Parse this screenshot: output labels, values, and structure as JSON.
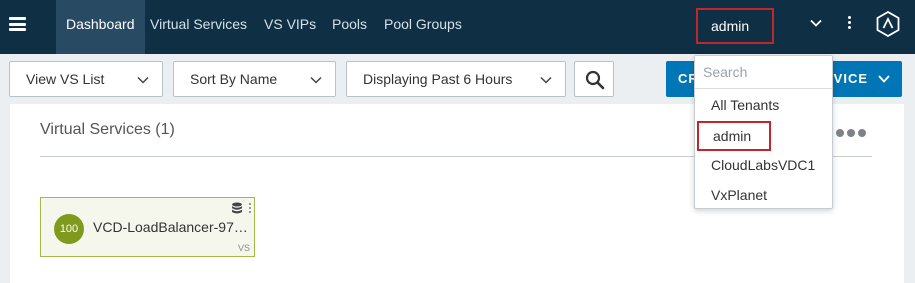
{
  "nav": {
    "tabs": [
      {
        "label": "Dashboard",
        "active": true
      },
      {
        "label": "Virtual Services",
        "active": false
      },
      {
        "label": "VS VIPs",
        "active": false
      },
      {
        "label": "Pools",
        "active": false
      },
      {
        "label": "Pool Groups",
        "active": false
      }
    ],
    "tenant": "admin"
  },
  "filters": {
    "view": "View VS List",
    "sort": "Sort By Name",
    "time": "Displaying Past 6 Hours",
    "create_left": "CR",
    "create_right": "VICE"
  },
  "panel": {
    "title": "Virtual Services (1)",
    "virtual_services": [
      {
        "health": "100",
        "name": "VCD-LoadBalancer-97c...",
        "tag": "VS"
      }
    ]
  },
  "tenant_menu": {
    "search_placeholder": "Search",
    "items": [
      "All Tenants",
      "admin",
      "CloudLabsVDC1",
      "VxPlanet"
    ],
    "selected": "admin"
  },
  "colors": {
    "nav_bg": "#0e2f44",
    "active_tab_bg": "#284b63",
    "primary_button": "#0076b6",
    "highlight_border": "#c0272d",
    "health_good": "#7f9a1c"
  }
}
